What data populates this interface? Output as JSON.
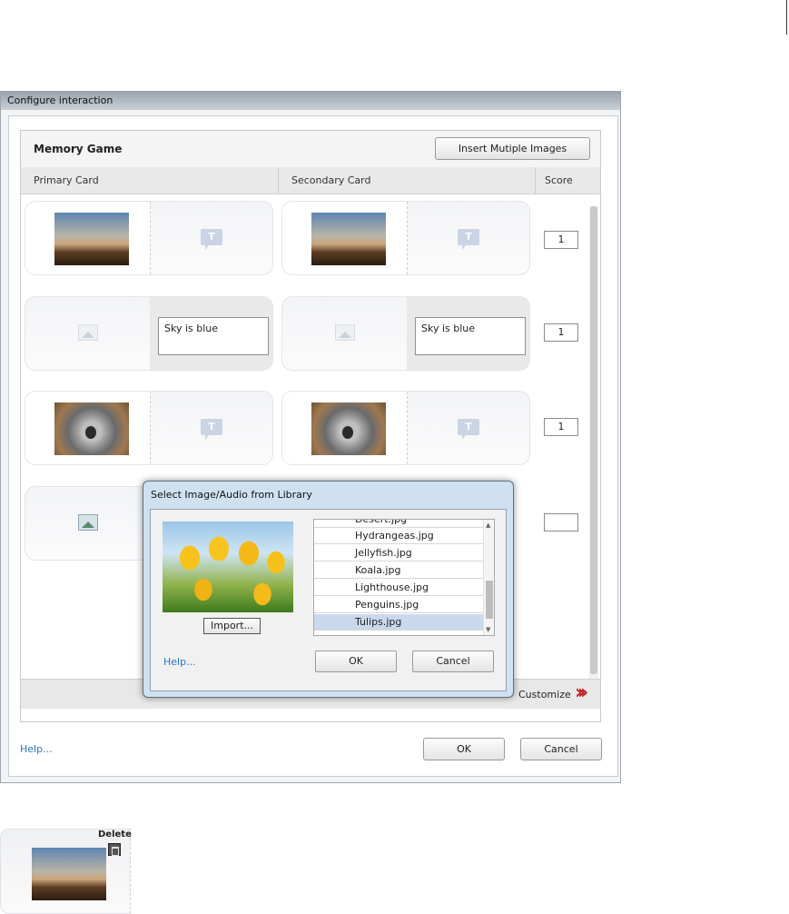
{
  "window": {
    "title": "Configure interaction"
  },
  "memory_game": {
    "title": "Memory Game",
    "insert_button": "Insert Mutiple Images",
    "columns": {
      "primary": "Primary Card",
      "secondary": "Secondary Card",
      "score": "Score"
    },
    "rows": [
      {
        "primary_image": "lighthouse",
        "secondary_image": "lighthouse",
        "score": "1"
      },
      {
        "primary_text": "Sky is blue",
        "secondary_text": "Sky is blue",
        "score": "1"
      },
      {
        "primary_image": "koala",
        "secondary_image": "koala",
        "score": "1"
      },
      {
        "score": ""
      }
    ],
    "customize_label": "Customize"
  },
  "footer": {
    "help": "Help...",
    "ok": "OK",
    "cancel": "Cancel"
  },
  "dialog": {
    "title": "Select Image/Audio from Library",
    "import_button": "Import...",
    "files": [
      "Desert.jpg",
      "Hydrangeas.jpg",
      "Jellyfish.jpg",
      "Koala.jpg",
      "Lighthouse.jpg",
      "Penguins.jpg",
      "Tulips.jpg"
    ],
    "selected_file": "Tulips.jpg",
    "help": "Help...",
    "ok": "OK",
    "cancel": "Cancel"
  },
  "delete_preview": {
    "label": "Delete"
  }
}
